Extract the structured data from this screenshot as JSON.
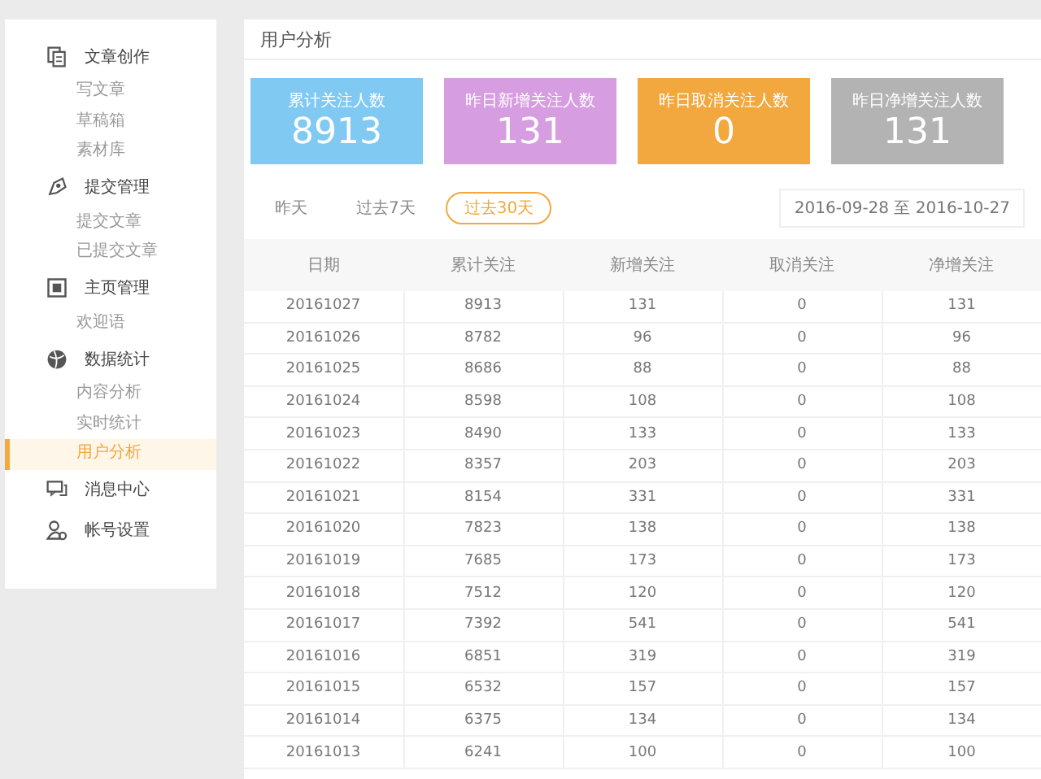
{
  "sidebar": {
    "groups": [
      {
        "label": "文章创作",
        "kind": "docs",
        "items": [
          {
            "label": "写文章",
            "selected": false
          },
          {
            "label": "草稿箱",
            "selected": false
          },
          {
            "label": "素材库",
            "selected": false
          }
        ]
      },
      {
        "label": "提交管理",
        "kind": "submit",
        "items": [
          {
            "label": "提交文章",
            "selected": false
          },
          {
            "label": "已提交文章",
            "selected": false
          }
        ]
      },
      {
        "label": "主页管理",
        "kind": "home",
        "items": [
          {
            "label": "欢迎语",
            "selected": false
          }
        ]
      },
      {
        "label": "数据统计",
        "kind": "stats",
        "items": [
          {
            "label": "内容分析",
            "selected": false
          },
          {
            "label": "实时统计",
            "selected": false
          },
          {
            "label": "用户分析",
            "selected": true
          }
        ]
      },
      {
        "label": "消息中心",
        "kind": "message"
      },
      {
        "label": "帐号设置",
        "kind": "account"
      }
    ]
  },
  "page_title": "用户分析",
  "stat_cards": [
    {
      "label": "累计关注人数",
      "value": "8913",
      "color": "#7fc9f2"
    },
    {
      "label": "昨日新增关注人数",
      "value": "131",
      "color": "#d69de0"
    },
    {
      "label": "昨日取消关注人数",
      "value": "0",
      "color": "#f2a83e"
    },
    {
      "label": "昨日净增关注人数",
      "value": "131",
      "color": "#b3b3b3"
    }
  ],
  "range_tabs": [
    {
      "label": "昨天",
      "selected": false
    },
    {
      "label": "过去7天",
      "selected": false
    },
    {
      "label": "过去30天",
      "selected": true
    }
  ],
  "date_range": "2016-09-28 至 2016-10-27",
  "table": {
    "columns": [
      "日期",
      "累计关注",
      "新增关注",
      "取消关注",
      "净增关注"
    ],
    "rows": [
      [
        "20161027",
        "8913",
        "131",
        "0",
        "131"
      ],
      [
        "20161026",
        "8782",
        "96",
        "0",
        "96"
      ],
      [
        "20161025",
        "8686",
        "88",
        "0",
        "88"
      ],
      [
        "20161024",
        "8598",
        "108",
        "0",
        "108"
      ],
      [
        "20161023",
        "8490",
        "133",
        "0",
        "133"
      ],
      [
        "20161022",
        "8357",
        "203",
        "0",
        "203"
      ],
      [
        "20161021",
        "8154",
        "331",
        "0",
        "331"
      ],
      [
        "20161020",
        "7823",
        "138",
        "0",
        "138"
      ],
      [
        "20161019",
        "7685",
        "173",
        "0",
        "173"
      ],
      [
        "20161018",
        "7512",
        "120",
        "0",
        "120"
      ],
      [
        "20161017",
        "7392",
        "541",
        "0",
        "541"
      ],
      [
        "20161016",
        "6851",
        "319",
        "0",
        "319"
      ],
      [
        "20161015",
        "6532",
        "157",
        "0",
        "157"
      ],
      [
        "20161014",
        "6375",
        "134",
        "0",
        "134"
      ],
      [
        "20161013",
        "6241",
        "100",
        "0",
        "100"
      ]
    ]
  }
}
